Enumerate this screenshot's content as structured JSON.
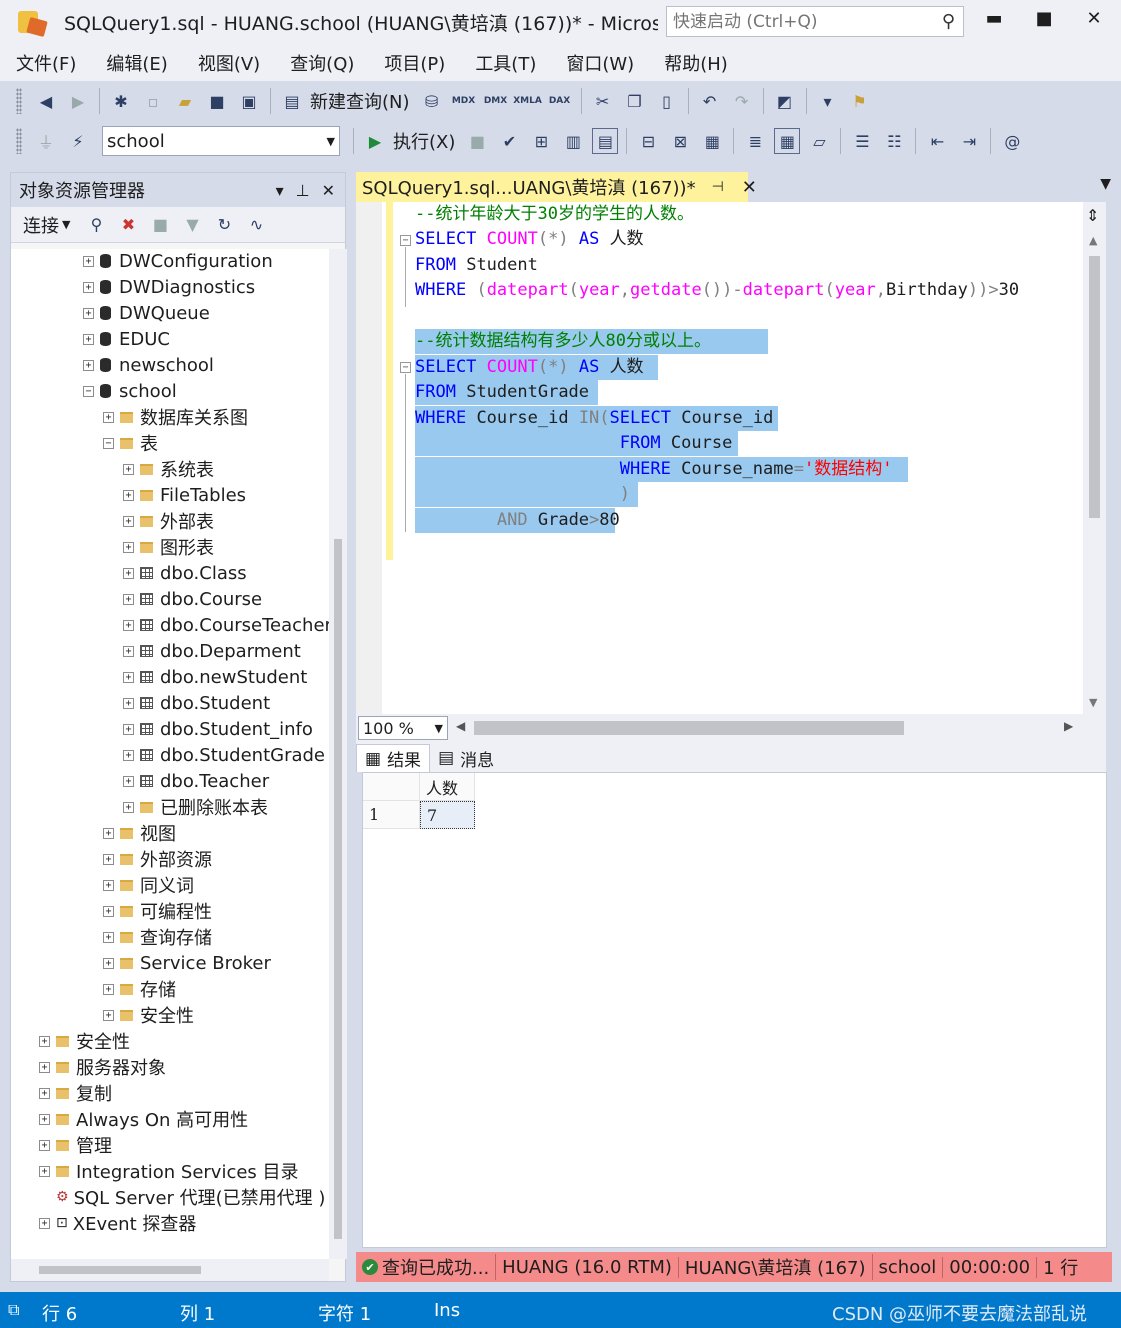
{
  "window": {
    "title": "SQLQuery1.sql - HUANG.school (HUANG\\黄培滇 (167))* - Microsoft...",
    "quick_launch_placeholder": "快速启动 (Ctrl+Q)",
    "min": "▬",
    "max": "■",
    "close": "✕"
  },
  "menu": [
    "文件(F)",
    "编辑(E)",
    "视图(V)",
    "查询(Q)",
    "项目(P)",
    "工具(T)",
    "窗口(W)",
    "帮助(H)"
  ],
  "toolbar": {
    "new_query": "新建查询(N)",
    "database": "school",
    "execute": "执行(X)",
    "mdx": "MDX",
    "dmx": "DMX",
    "xmla": "XMLA",
    "dax": "DAX"
  },
  "object_explorer": {
    "title": "对象资源管理器",
    "connect": "连接",
    "nodes": [
      {
        "label": "DWConfiguration",
        "type": "db",
        "expanded": false
      },
      {
        "label": "DWDiagnostics",
        "type": "db",
        "expanded": false
      },
      {
        "label": "DWQueue",
        "type": "db",
        "expanded": false
      },
      {
        "label": "EDUC",
        "type": "db",
        "expanded": false
      },
      {
        "label": "newschool",
        "type": "db",
        "expanded": false
      },
      {
        "label": "school",
        "type": "db",
        "expanded": true
      },
      {
        "label": "数据库关系图",
        "type": "folder",
        "expanded": false
      },
      {
        "label": "表",
        "type": "folder",
        "expanded": true
      },
      {
        "label": "系统表",
        "type": "folder",
        "expanded": false
      },
      {
        "label": "FileTables",
        "type": "folder",
        "expanded": false
      },
      {
        "label": "外部表",
        "type": "folder",
        "expanded": false
      },
      {
        "label": "图形表",
        "type": "folder",
        "expanded": false
      },
      {
        "label": "dbo.Class",
        "type": "table",
        "expanded": false
      },
      {
        "label": "dbo.Course",
        "type": "table",
        "expanded": false
      },
      {
        "label": "dbo.CourseTeacher",
        "type": "table",
        "expanded": false
      },
      {
        "label": "dbo.Deparment",
        "type": "table",
        "expanded": false
      },
      {
        "label": "dbo.newStudent",
        "type": "table",
        "expanded": false
      },
      {
        "label": "dbo.Student",
        "type": "table",
        "expanded": false
      },
      {
        "label": "dbo.Student_info",
        "type": "table",
        "expanded": false
      },
      {
        "label": "dbo.StudentGrade",
        "type": "table",
        "expanded": false
      },
      {
        "label": "dbo.Teacher",
        "type": "table",
        "expanded": false
      },
      {
        "label": "已删除账本表",
        "type": "folder",
        "expanded": false
      },
      {
        "label": "视图",
        "type": "folder",
        "expanded": false
      },
      {
        "label": "外部资源",
        "type": "folder",
        "expanded": false
      },
      {
        "label": "同义词",
        "type": "folder",
        "expanded": false
      },
      {
        "label": "可编程性",
        "type": "folder",
        "expanded": false
      },
      {
        "label": "查询存储",
        "type": "folder",
        "expanded": false
      },
      {
        "label": "Service Broker",
        "type": "folder",
        "expanded": false
      },
      {
        "label": "存储",
        "type": "folder",
        "expanded": false
      },
      {
        "label": "安全性",
        "type": "folder",
        "expanded": false
      },
      {
        "label": "安全性",
        "type": "folder",
        "expanded": false
      },
      {
        "label": "服务器对象",
        "type": "folder",
        "expanded": false
      },
      {
        "label": "复制",
        "type": "folder",
        "expanded": false
      },
      {
        "label": "Always On 高可用性",
        "type": "folder",
        "expanded": false
      },
      {
        "label": "管理",
        "type": "folder",
        "expanded": false
      },
      {
        "label": "Integration Services 目录",
        "type": "folder",
        "expanded": false
      },
      {
        "label": "SQL Server 代理(已禁用代理 )",
        "type": "agent",
        "expanded": null
      },
      {
        "label": "XEvent 探查器",
        "type": "xevent",
        "expanded": false
      }
    ]
  },
  "editor": {
    "tab_label": "SQLQuery1.sql...UANG\\黄培滇 (167))*",
    "zoom": "100 %",
    "code": {
      "c1": "--统计年龄大于30岁的学生的人数。",
      "l2": {
        "k1": "SELECT",
        "f1": "COUNT",
        "p1": "(*)",
        "k2": "AS",
        "t1": "人数"
      },
      "l3": {
        "k1": "FROM",
        "t1": "Student"
      },
      "l4": {
        "k1": "WHERE",
        "g1": "(",
        "f1": "datepart",
        "g2": "(",
        "f2": "year",
        "g3": ",",
        "f3": "getdate",
        "g4": "())-",
        "f4": "datepart",
        "g5": "(",
        "f5": "year",
        "g6": ",",
        "t1": "Birthday",
        "g7": "))>",
        "t2": "30"
      },
      "c2": "--统计数据结构有多少人80分或以上。",
      "l7": {
        "k1": "SELECT",
        "f1": "COUNT",
        "p1": "(*)",
        "k2": "AS",
        "t1": "人数"
      },
      "l8": {
        "k1": "FROM",
        "t1": "StudentGrade"
      },
      "l9": {
        "k1": "WHERE",
        "t1": "Course_id",
        "g1": "IN(",
        "k2": "SELECT",
        "t2": "Course_id"
      },
      "l10": {
        "k1": "FROM",
        "t1": "Course"
      },
      "l11": {
        "k1": "WHERE",
        "t1": "Course_name",
        "g1": "=",
        "s1": "'数据结构'"
      },
      "l12": {
        "g1": ")"
      },
      "l13": {
        "g1": "AND",
        "t1": "Grade",
        "g2": ">",
        "t2": "80"
      }
    }
  },
  "results": {
    "tab_results": "结果",
    "tab_messages": "消息",
    "columns": [
      "人数"
    ],
    "rows": [
      {
        "row_num": "1",
        "values": [
          "7"
        ]
      }
    ]
  },
  "query_status": {
    "message": "查询已成功...",
    "server": "HUANG (16.0 RTM)",
    "user": "HUANG\\黄培滇 (167)",
    "database": "school",
    "elapsed": "00:00:00",
    "rows": "1 行"
  },
  "statusbar": {
    "line": "行 6",
    "col": "列 1",
    "char": "字符 1",
    "mode": "Ins",
    "watermark": "CSDN @巫师不要去魔法部乱说"
  },
  "colors": {
    "accent_blue": "#0079cc",
    "tab_yellow": "#fff29d",
    "selection": "#99c9ef",
    "status_red": "#f48a8a"
  }
}
